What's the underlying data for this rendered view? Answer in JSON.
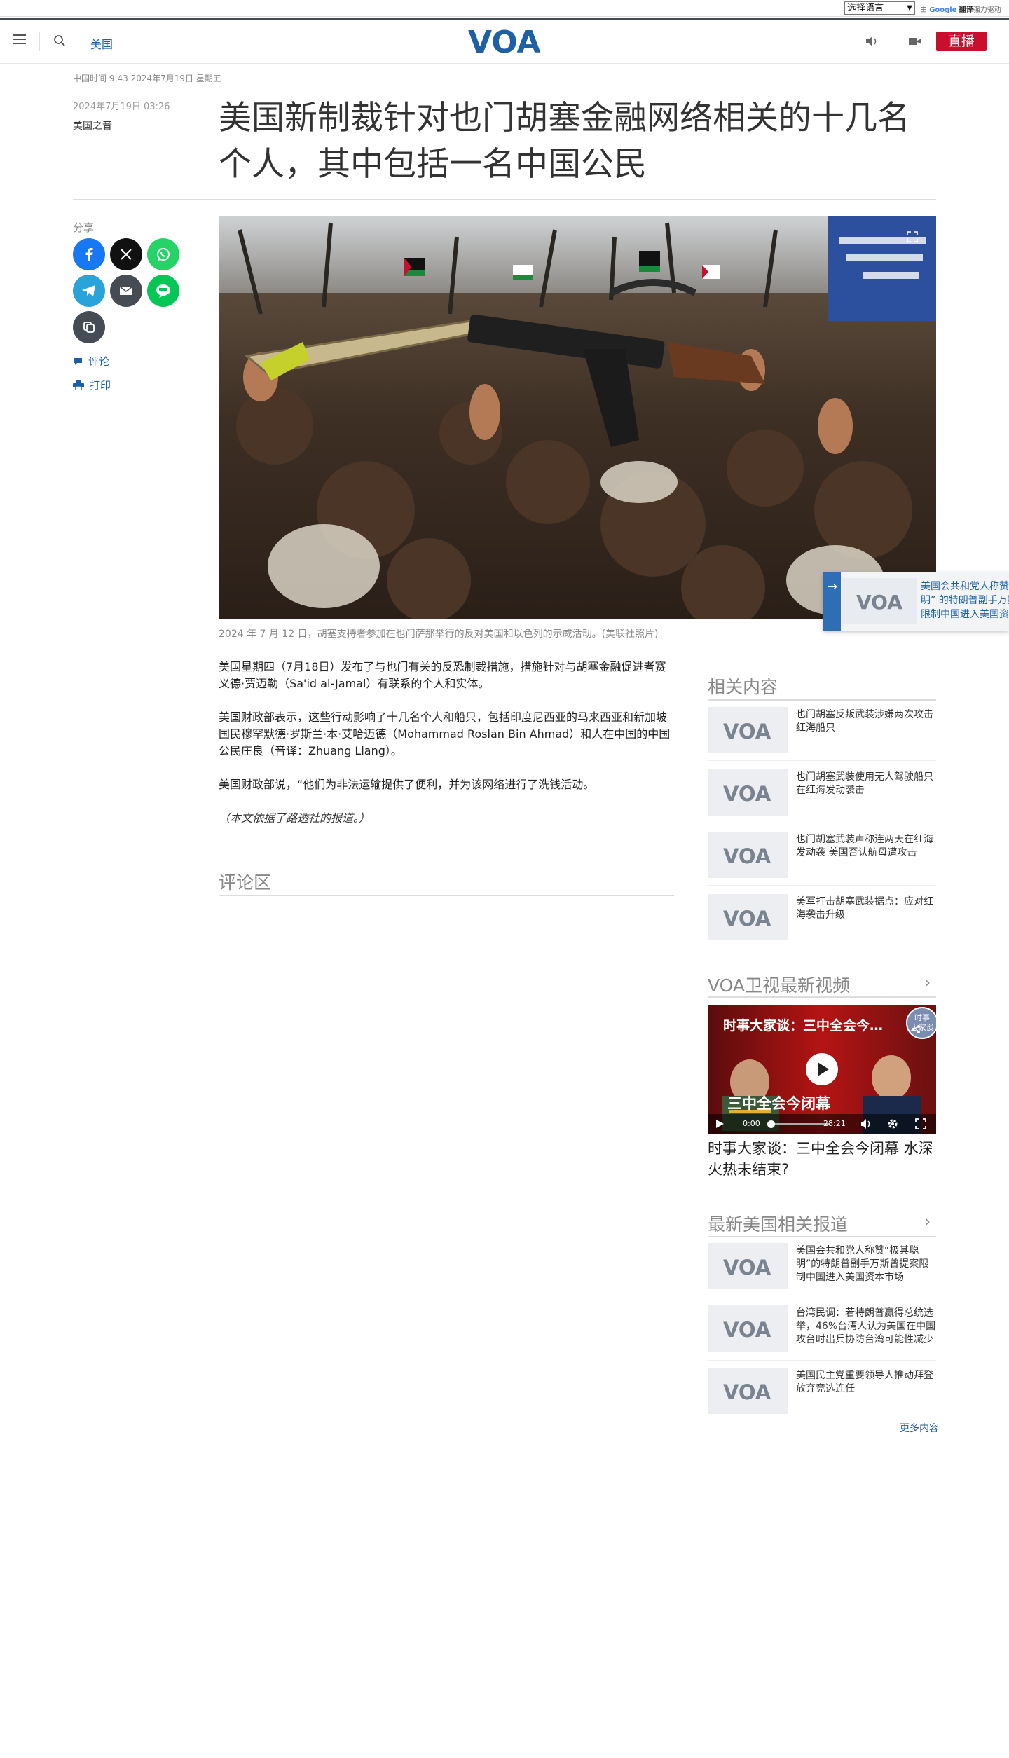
{
  "translate_bar": {
    "select_label": "选择语言",
    "powered_prefix": "由",
    "google": "Google",
    "translate": "翻译",
    "powered_suffix": "强力驱动"
  },
  "header": {
    "section": "美国",
    "logo": "VOA",
    "live": "直播"
  },
  "meta": {
    "dateline": "中国时间 9:43 2024年7月19日 星期五",
    "published": "2024年7月19日 03:26",
    "author": "美国之音"
  },
  "headline": "美国新制裁针对也门胡塞金融网络相关的十几名个人，其中包括一名中国公民",
  "share": {
    "label": "分享",
    "comment": "评论",
    "print": "打印"
  },
  "hero": {
    "caption": "2024 年 7 月 12 日，胡塞支持者参加在也门萨那举行的反对美国和以色列的示威活动。(美联社照片)"
  },
  "float_card": {
    "text_lines": [
      "美国会共和党人称赞",
      "明” 的特朗普副手万斯",
      "限制中国进入美国资"
    ]
  },
  "article": {
    "paragraphs": [
      "美国星期四（7月18日）发布了与也门有关的反恐制裁措施，措施针对与胡塞金融促进者赛义德·贾迈勒（Sa'id al-Jamal）有联系的个人和实体。",
      "美国财政部表示，这些行动影响了十几名个人和船只，包括印度尼西亚的马来西亚和新加坡国民穆罕默德·罗斯兰·本·艾哈迈德（Mohammad Roslan Bin Ahmad）和人在中国的中国公民庄良（音译：Zhuang Liang）。",
      "美国财政部说，“他们为非法运输提供了便利，并为该网络进行了洗钱活动。"
    ],
    "note": "（本文依据了路透社的报道。）",
    "comments_title": "评论区"
  },
  "related": {
    "title": "相关内容",
    "items": [
      "也门胡塞反叛武装涉嫌两次攻击红海船只",
      "也门胡塞武装使用无人驾驶船只在红海发动袭击",
      "也门胡塞武装声称连两天在红海发动袭 美国否认航母遭攻击",
      "美军打击胡塞武装据点：应对红海袭击升级"
    ]
  },
  "video_section": {
    "title": "VOA卫视最新视频",
    "overlay_title": "时事大家谈：三中全会今…",
    "banner_text": "三中全会今闭幕",
    "corner_badge": "时事大家谈",
    "time_current": "0:00",
    "time_total": "28:21",
    "progress_fraction": 0.0,
    "video_title": "时事大家谈：三中全会今闭幕 水深火热未结束?"
  },
  "latest": {
    "title": "最新美国相关报道",
    "items": [
      "美国会共和党人称赞“极其聪明”的特朗普副手万斯曾提案限制中国进入美国资本市场",
      "台湾民调：若特朗普赢得总统选举，46%台湾人认为美国在中国攻台时出兵协防台湾可能性减少",
      "美国民主党重要领导人推动拜登放弃竞选连任"
    ],
    "more": "更多内容"
  },
  "colors": {
    "brand_blue": "#1a5fa8",
    "live_red": "#c8102e",
    "logo_blue": "#1e5fa6"
  }
}
